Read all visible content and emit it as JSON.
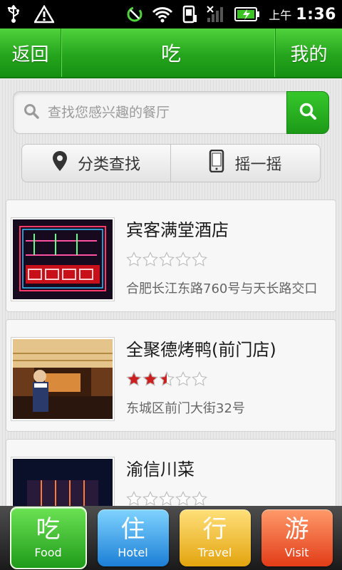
{
  "status_bar": {
    "icons": [
      "usb-icon",
      "warning-icon",
      "sync-icon",
      "wifi-icon",
      "phone-icon",
      "signal-icon",
      "battery-charging-icon"
    ],
    "ampm": "上午",
    "time": "1:36"
  },
  "header": {
    "back_label": "返回",
    "title": "吃",
    "mine_label": "我的"
  },
  "search": {
    "placeholder": "查找您感兴趣的餐厅",
    "icon": "search-icon",
    "button_icon": "search-icon"
  },
  "actions": {
    "category_label": "分类查找",
    "category_icon": "location-pin-icon",
    "shake_label": "摇一摇",
    "shake_icon": "phone-icon"
  },
  "restaurants": [
    {
      "name": "宾客满堂酒店",
      "rating": 0,
      "address": "合肥长江东路760号与天长路交口",
      "image": "neon-sign-photo"
    },
    {
      "name": "全聚德烤鸭(前门店)",
      "rating": 2.5,
      "address": "东城区前门大街32号",
      "image": "restaurant-interior-photo"
    },
    {
      "name": "渝信川菜",
      "rating": 0,
      "address": "",
      "image": "night-building-photo"
    }
  ],
  "tabs": [
    {
      "glyph": "吃",
      "label": "Food",
      "active": true
    },
    {
      "glyph": "住",
      "label": "Hotel",
      "active": false
    },
    {
      "glyph": "行",
      "label": "Travel",
      "active": false
    },
    {
      "glyph": "游",
      "label": "Visit",
      "active": false
    }
  ],
  "colors": {
    "brand_green": "#25a51d",
    "star_filled": "#cc2020",
    "star_empty": "#ffffff"
  }
}
